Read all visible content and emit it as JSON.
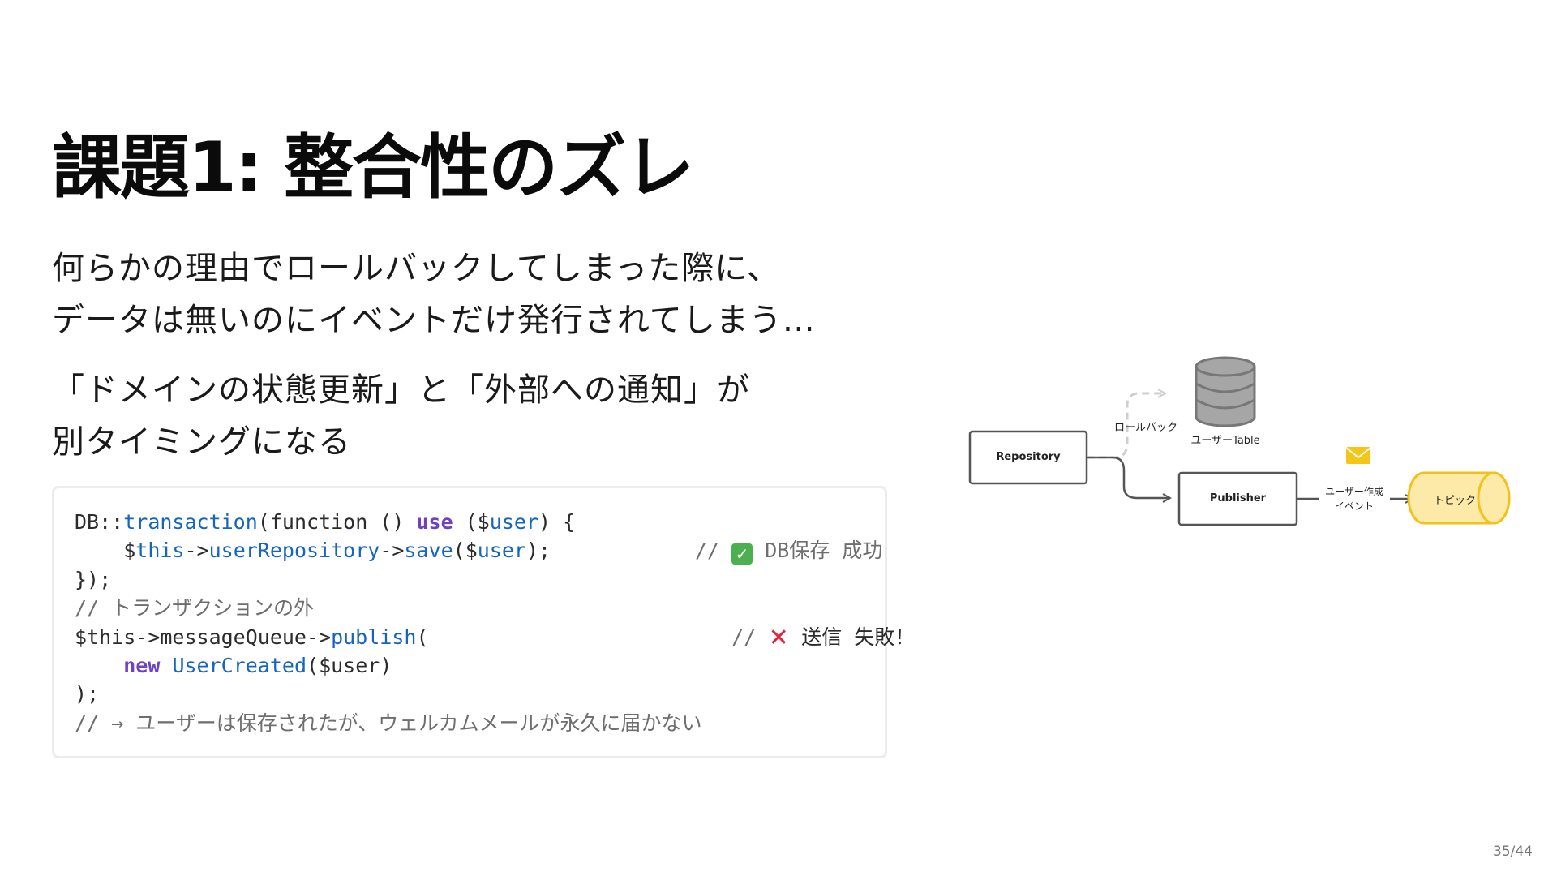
{
  "slide": {
    "title": "課題1: 整合性のズレ",
    "paragraph1": [
      "何らかの理由でロールバックしてしまった際に、",
      "データは無いのにイベントだけ発行されてしまう…"
    ],
    "paragraph2": [
      "「ドメインの状態更新」と「外部への通知」が",
      "別タイミングになる"
    ],
    "page_number": "35/44"
  },
  "code": {
    "line1": {
      "a": "DB::",
      "b": "transaction",
      "c": "(function () ",
      "d": "use",
      "e": " ($",
      "f": "user",
      "g": ") {"
    },
    "line2": {
      "a": "    $",
      "b": "this",
      "c": "->",
      "d": "userRepository",
      "e": "->",
      "f": "save",
      "g": "($",
      "h": "user",
      "i": ");",
      "comment_prefix": "// ",
      "comment_text": " DB保存 成功"
    },
    "line3": "});",
    "line4": "// トランザクションの外",
    "line5": {
      "a": "$this->messageQueue->",
      "b": "publish",
      "c": "(",
      "comment_prefix": "// ",
      "comment_text": " 送信 失敗！"
    },
    "line6": {
      "indent": "    ",
      "kw": "new",
      "sp": " ",
      "cls": "UserCreated",
      "rest": "($user)"
    },
    "line7": ");",
    "line8": "// → ユーザーは保存されたが、ウェルカムメールが永久に届かない"
  },
  "diagram": {
    "repository_label": "Repository",
    "publisher_label": "Publisher",
    "rollback_label": "ロールバック",
    "db_label": "ユーザーTable",
    "event_label_line1": "ユーザー作成",
    "event_label_line2": "イベント",
    "topic_label": "トピック",
    "colors": {
      "topic_fill": "#fde9a8",
      "topic_stroke": "#f2c21b",
      "envelope": "#f5c518",
      "db_fill": "#a6a6a6"
    }
  }
}
